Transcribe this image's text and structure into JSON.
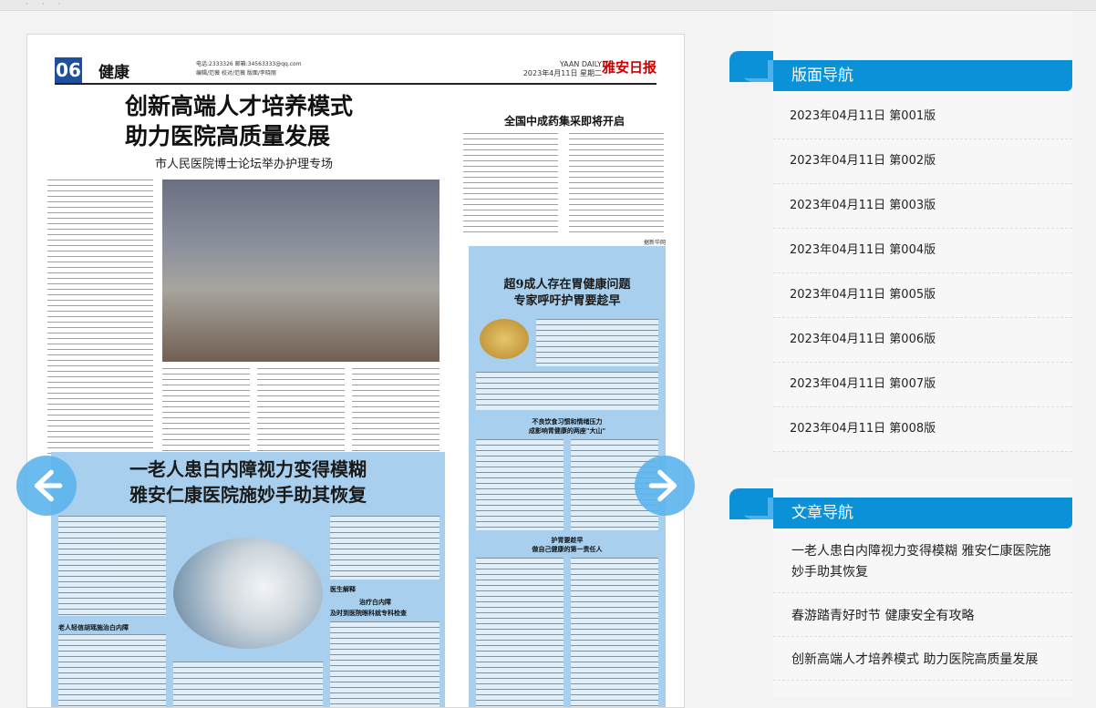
{
  "paper": {
    "page_no": "06",
    "section": "健康",
    "meta": "电话:2333326  邮箱:34563333@qq.com\n编辑/范薇   校对/范薇   版面/李晓丽",
    "brand": "YAAN DAILY\n2023年4月11日 星期二",
    "logo": "雅安日报",
    "article1": {
      "title_line1": "创新高端人才培养模式",
      "title_line2": "助力医院高质量发展",
      "subtitle": "市人民医院博士论坛举办护理专场"
    },
    "article2": {
      "title": "全国中成药集采即将开启",
      "author": "据新华网"
    },
    "article3": {
      "title_line1": "超9成人存在胃健康问题",
      "title_line2": "专家呼吁护胃要趁早",
      "sub1": "不良饮食习惯和情绪压力",
      "sub2": "成影响胃健康的两座\"大山\"",
      "sub3": "护胃要趁早",
      "sub4": "做自己健康的第一责任人"
    },
    "article4": {
      "title_line1": "一老人患白内障视力变得模糊",
      "title_line2": "雅安仁康医院施妙手助其恢复",
      "label1": "老人轻信胡瑶施治白内障",
      "label2": "医生解释",
      "label3": "治疗白内障",
      "label4": "及时到医院眼科就专科检查"
    }
  },
  "sidebar": {
    "layout_nav_title": "版面导航",
    "layout_items": [
      "2023年04月11日  第001版",
      "2023年04月11日  第002版",
      "2023年04月11日  第003版",
      "2023年04月11日  第004版",
      "2023年04月11日  第005版",
      "2023年04月11日  第006版",
      "2023年04月11日  第007版",
      "2023年04月11日  第008版"
    ],
    "article_nav_title": "文章导航",
    "article_items": [
      "一老人患白内障视力变得模糊  雅安仁康医院施妙手助其恢复",
      "春游踏青好时节  健康安全有攻略",
      "创新高端人才培养模式  助力医院高质量发展"
    ]
  },
  "colors": {
    "accent": "#0b91d8",
    "arrow": "#5bb4ec",
    "highlight": "#a8d0ee"
  },
  "icons": {
    "prev": "arrow-left-icon",
    "next": "arrow-right-icon"
  }
}
